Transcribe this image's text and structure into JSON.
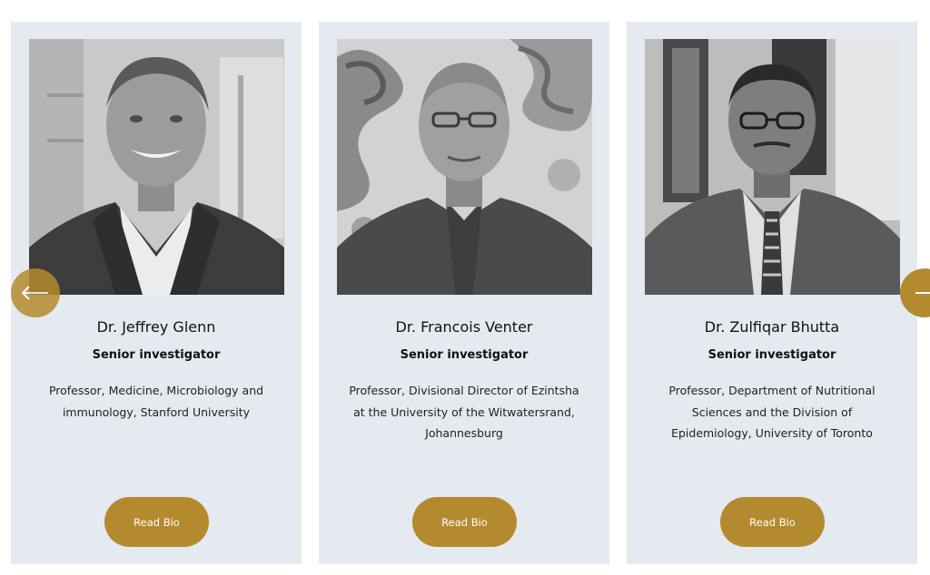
{
  "carousel": {
    "cards": [
      {
        "name": "Dr. Jeffrey Glenn",
        "role": "Senior investigator",
        "description": "Professor, Medicine, Microbiology and immunology, Stanford University",
        "button_label": "Read Bio",
        "photo_icon": "portrait-photo"
      },
      {
        "name": "Dr. Francois Venter",
        "role": "Senior investigator",
        "description": "Professor, Divisional Director of Ezintsha at the University of the Witwatersrand, Johannesburg",
        "button_label": "Read Bio",
        "photo_icon": "portrait-photo"
      },
      {
        "name": "Dr. Zulfiqar Bhutta",
        "role": "Senior investigator",
        "description": "Professor, Department of Nutritional Sciences and the Division of Epidemiology, University of Toronto",
        "button_label": "Read Bio",
        "photo_icon": "portrait-photo"
      }
    ],
    "prev_icon": "arrow-left-icon",
    "next_icon": "arrow-right-icon"
  },
  "colors": {
    "card_background": "#e4eaf0",
    "accent": "#b48a2e",
    "text": "#111111"
  }
}
